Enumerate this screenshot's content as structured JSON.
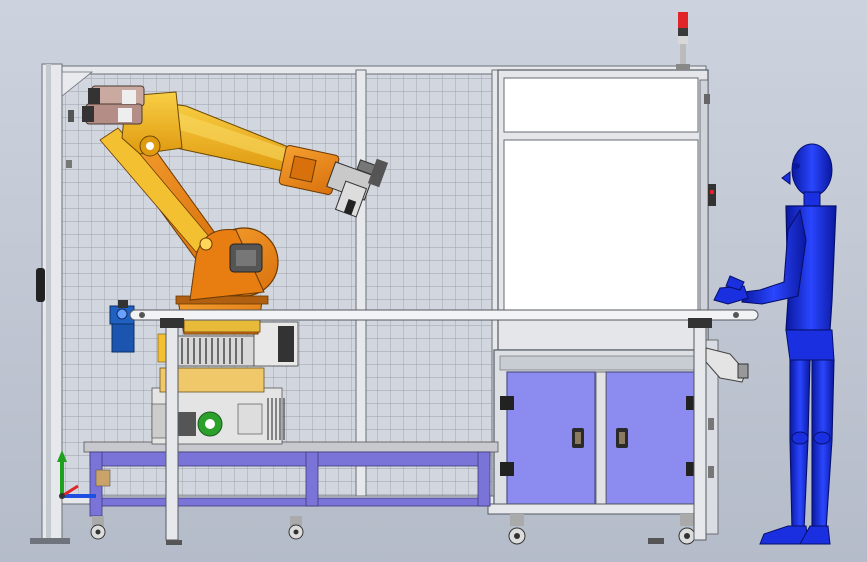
{
  "viewport": {
    "background_top": "#cdd3de",
    "background_bottom": "#b5bcc9"
  },
  "colors": {
    "robot_orange": "#f08a1c",
    "robot_yellow": "#f2b51f",
    "robot_gripper": "#c9a9a0",
    "cabinet_blue": "#8c8cf0",
    "base_frame_blue": "#7b74d8",
    "mannequin_blue": "#1a2fe0",
    "frame_silver": "#dadde3",
    "mesh": "#9aa0ab",
    "signal_light_red": "#e0242a",
    "pump_blue": "#2060c0"
  },
  "icons": [
    "coordinate-triad-icon",
    "signal-tower-icon",
    "door-handle-icon",
    "caster-wheel-icon"
  ]
}
